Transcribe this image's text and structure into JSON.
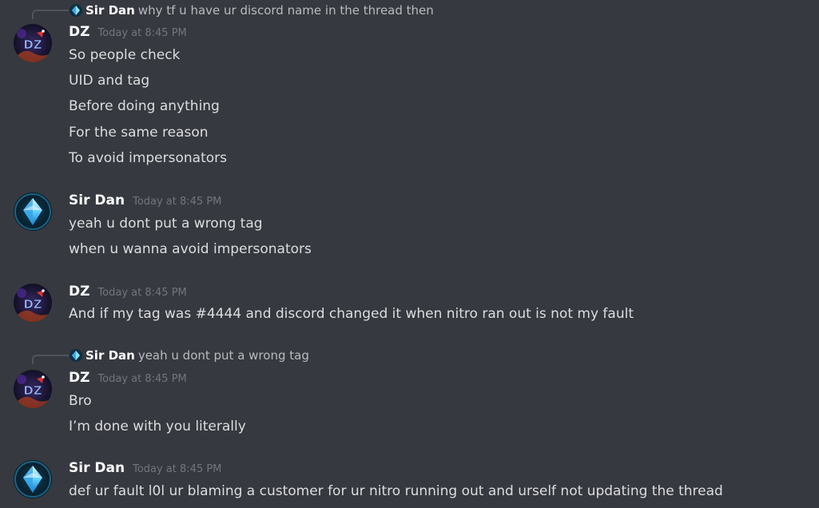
{
  "colors": {
    "background": "#36393f",
    "username": "#ffffff",
    "timestamp": "#72767d",
    "text": "#dcddde"
  },
  "replies": [
    {
      "name": "Sir Dan",
      "text": "why tf u have ur discord name in the thread then",
      "icon": "crystal-avatar-icon"
    },
    {
      "name": "Sir Dan",
      "text": "yeah u dont put a wrong tag",
      "icon": "crystal-avatar-icon"
    }
  ],
  "messages": [
    {
      "author": "DZ",
      "timestamp": "Today at 8:45 PM",
      "lines": [
        "So people check",
        "UID and tag",
        "Before doing anything",
        "For the same reason",
        "To avoid impersonators"
      ]
    },
    {
      "author": "Sir Dan",
      "timestamp": "Today at 8:45 PM",
      "lines": [
        "yeah u dont put a wrong tag",
        "when u wanna avoid impersonators"
      ]
    },
    {
      "author": "DZ",
      "timestamp": "Today at 8:45 PM",
      "lines": [
        "And if my tag was #4444 and discord changed it when nitro ran out is not my fault"
      ]
    },
    {
      "author": "DZ",
      "timestamp": "Today at 8:45 PM",
      "lines": [
        "Bro",
        "I’m done with you literally"
      ]
    },
    {
      "author": "Sir Dan",
      "timestamp": "Today at 8:45 PM",
      "lines": [
        "def ur fault l0l ur blaming a customer for ur nitro running out and urself not updating the thread"
      ]
    }
  ]
}
